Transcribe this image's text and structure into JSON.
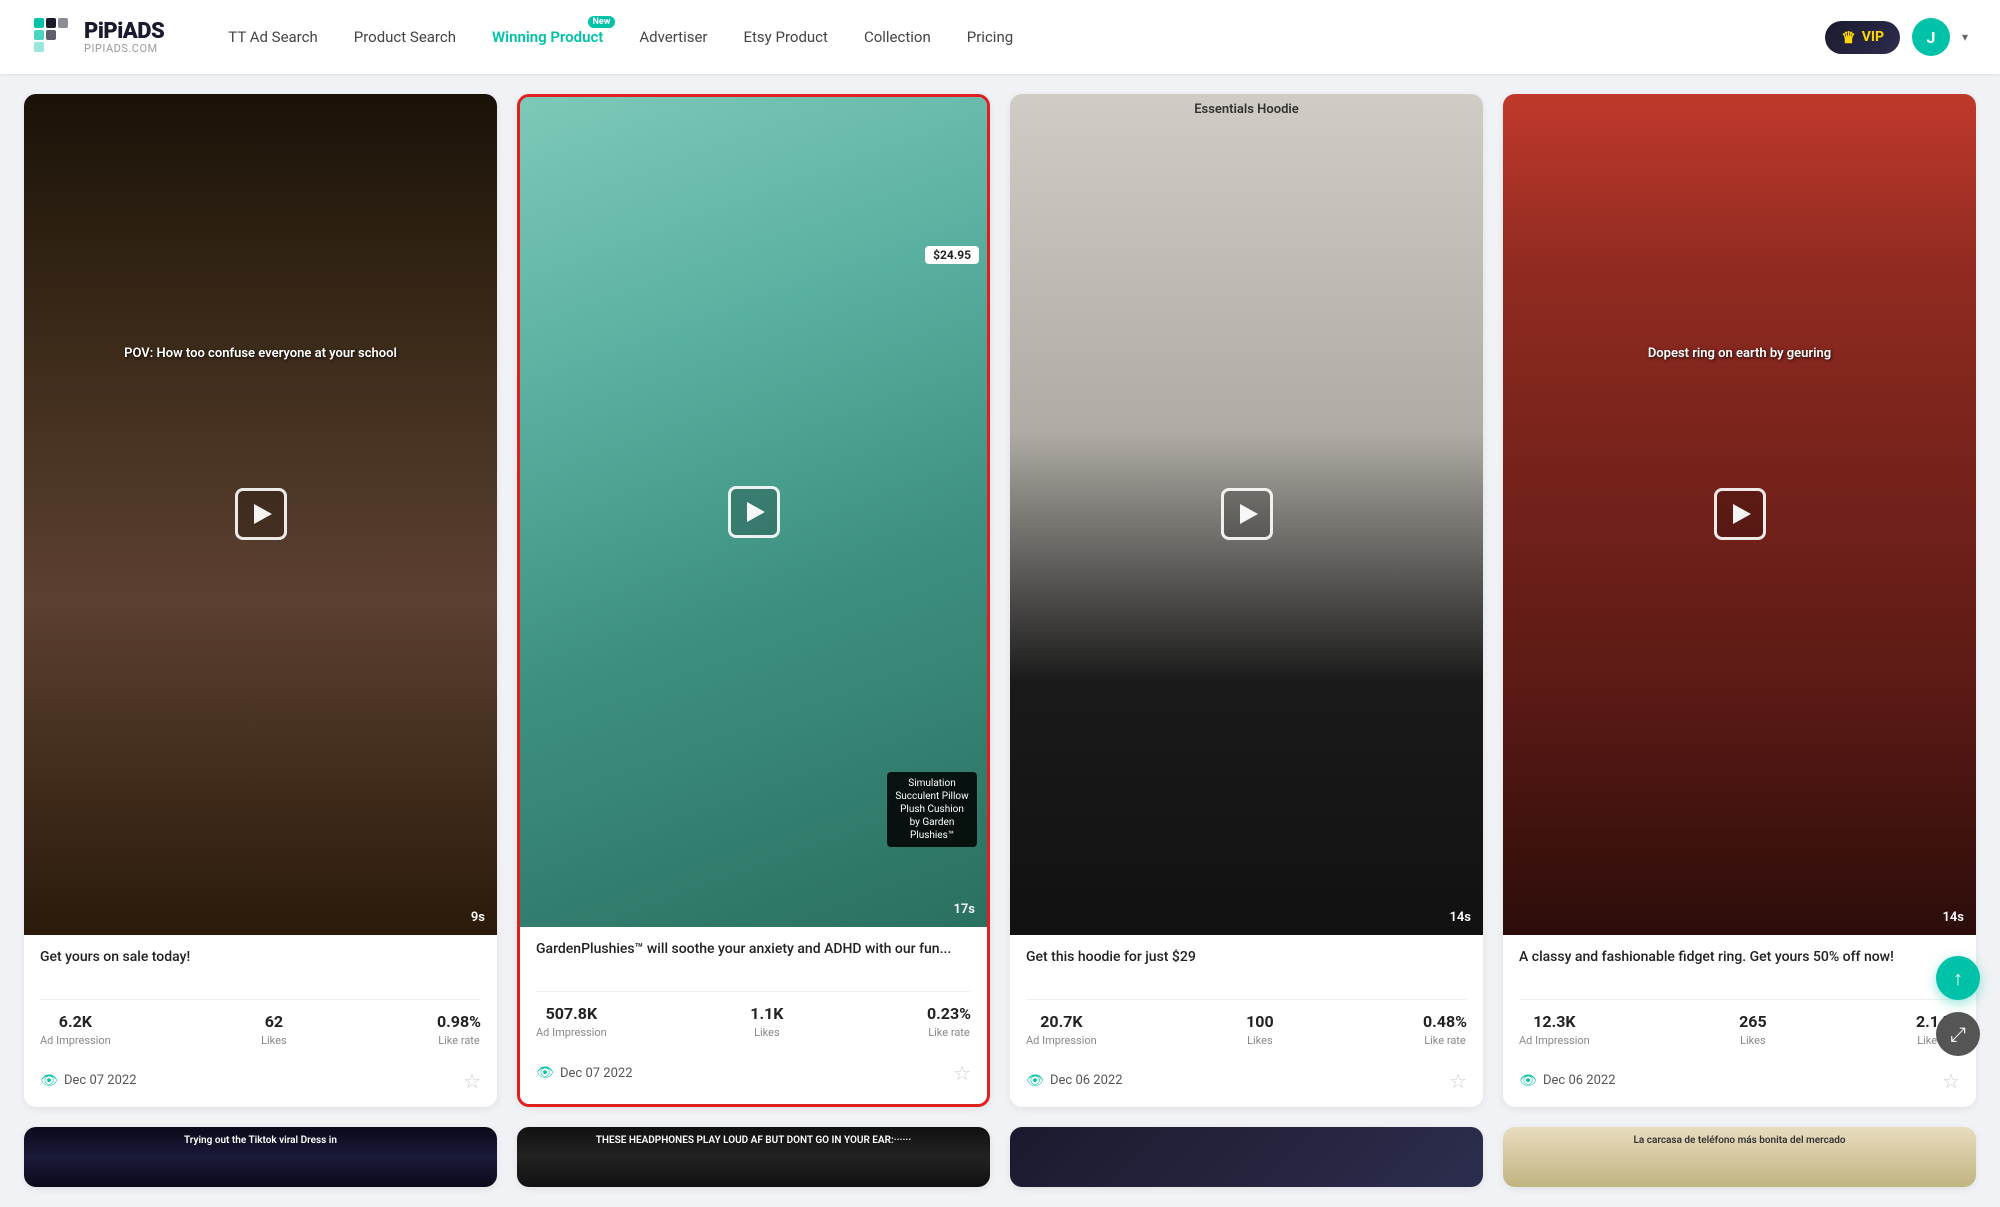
{
  "nav": {
    "logo_main": "PiPiADS",
    "logo_sub": "PIPIADS.COM",
    "links": [
      {
        "id": "tt-ad-search",
        "label": "TT Ad Search",
        "active": false,
        "badge": null
      },
      {
        "id": "product-search",
        "label": "Product Search",
        "active": false,
        "badge": null
      },
      {
        "id": "winning-product",
        "label": "Winning Product",
        "active": true,
        "badge": "New"
      },
      {
        "id": "advertiser",
        "label": "Advertiser",
        "active": false,
        "badge": null
      },
      {
        "id": "etsy-product",
        "label": "Etsy Product",
        "active": false,
        "badge": null
      },
      {
        "id": "collection",
        "label": "Collection",
        "active": false,
        "badge": null
      },
      {
        "id": "pricing",
        "label": "Pricing",
        "active": false,
        "badge": null
      }
    ],
    "vip_label": "VIP",
    "avatar_letter": "J"
  },
  "cards": [
    {
      "id": "card-1",
      "highlighted": false,
      "thumb_class": "thumb-1",
      "overlay_text": "POV: How too confuse everyone at your school",
      "duration": "9s",
      "title": "Get yours on sale today!",
      "ad_impression": "6.2K",
      "likes": "62",
      "like_rate": "0.98%",
      "date": "Dec 07 2022"
    },
    {
      "id": "card-2",
      "highlighted": true,
      "thumb_class": "thumb-2",
      "price": "$24.95",
      "product_label": "Simulation Succulent Pillow Plush Cushion by Garden Plushies™",
      "duration": "17s",
      "title": "GardenPlushies™ will soothe your anxiety and ADHD with our fun...",
      "ad_impression": "507.8K",
      "likes": "1.1K",
      "like_rate": "0.23%",
      "date": "Dec 07 2022"
    },
    {
      "id": "card-3",
      "highlighted": false,
      "thumb_class": "thumb-3",
      "essentials_text": "Essentials Hoodie",
      "duration": "14s",
      "title": "Get this hoodie for just $29",
      "ad_impression": "20.7K",
      "likes": "100",
      "like_rate": "0.48%",
      "date": "Dec 06 2022"
    },
    {
      "id": "card-4",
      "highlighted": false,
      "thumb_class": "thumb-4",
      "overlay_text": "Dopest ring on earth by geuring",
      "duration": "14s",
      "title": "A classy and fashionable fidget ring. Get yours 50% off now!",
      "ad_impression": "12.3K",
      "likes": "265",
      "like_rate": "2.14%",
      "date": "Dec 06 2022"
    }
  ],
  "partial_cards": [
    {
      "id": "partial-1",
      "thumb_class": "thumb-5",
      "text": "Trying out the Tiktok viral Dress in"
    },
    {
      "id": "partial-2",
      "thumb_class": "thumb-6",
      "text": "THESE HEADPHONES PLAY LOUD AF BUT DONT GO IN YOUR EAR:······"
    },
    {
      "id": "partial-3",
      "thumb_class": "thumb-7",
      "text": ""
    },
    {
      "id": "partial-4",
      "thumb_class": "thumb-8",
      "text": "La carcasa de teléfono más bonita del mercado"
    }
  ],
  "labels": {
    "ad_impression": "Ad Impression",
    "likes": "Likes",
    "like_rate": "Like rate"
  }
}
